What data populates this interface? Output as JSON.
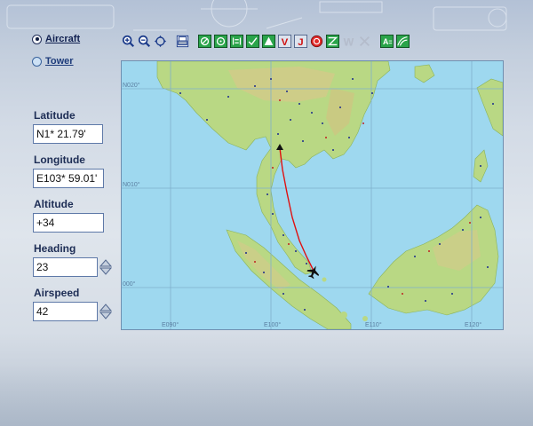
{
  "mode": {
    "aircraft_label": "Aircraft",
    "tower_label": "Tower",
    "selected": "Aircraft"
  },
  "fields": {
    "latitude": {
      "label": "Latitude",
      "value": "N1* 21.79'"
    },
    "longitude": {
      "label": "Longitude",
      "value": "E103* 59.01'"
    },
    "altitude": {
      "label": "Altitude",
      "value": "+34"
    },
    "heading": {
      "label": "Heading",
      "value": "23"
    },
    "airspeed": {
      "label": "Airspeed",
      "value": "42"
    }
  },
  "toolbar": {
    "icons": [
      "zoom-in-icon",
      "zoom-out-icon",
      "center-icon",
      "print-icon",
      "airport-icon",
      "vor-icon",
      "ndb-icon",
      "intersection-icon",
      "approach-icon",
      "victor-airway-icon",
      "jet-airway-icon",
      "airspace-icon",
      "route-icon",
      "waypoint-icon",
      "clear-icon",
      "map-text-icon",
      "terrain-icon"
    ]
  },
  "map": {
    "lat_labels": [
      "N020°",
      "N010°",
      "000°"
    ],
    "lon_labels": [
      "E090°",
      "E100°",
      "E110°",
      "E120°"
    ],
    "colors": {
      "water": "#9ed8ef",
      "land": "#b9d884",
      "highlands": "#d6c98a",
      "grid": "#7fb0cc",
      "route": "#e01010"
    }
  }
}
